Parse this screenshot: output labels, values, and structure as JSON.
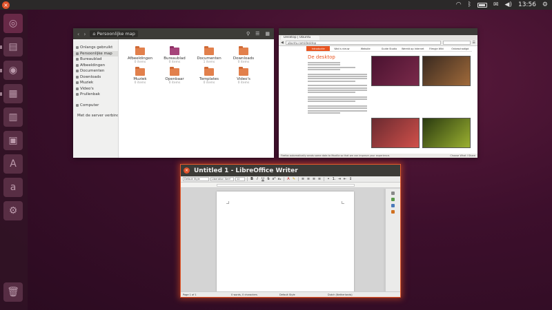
{
  "top_panel": {
    "close_glyph": "×",
    "clock": "13:56",
    "icons": [
      "wifi-icon",
      "bluetooth-icon",
      "battery-icon",
      "envelope-icon",
      "volume-icon",
      "gear-icon"
    ]
  },
  "launcher": {
    "items": [
      "dash-icon",
      "files-icon",
      "firefox-icon",
      "writer-icon",
      "calc-icon",
      "impress-icon",
      "font-icon",
      "amazon-icon",
      "settings-icon",
      "trash-icon"
    ]
  },
  "files": {
    "path": "⌂ Persoonlijke map",
    "sidebar": [
      "Onlangs gebruikt",
      "Persoonlijke map",
      "Bureaublad",
      "Afbeeldingen",
      "Documenten",
      "Downloads",
      "Muziek",
      "Video's",
      "Prullenbak",
      "Computer",
      "Met de server verbinden"
    ],
    "folders": [
      {
        "name": "Afbeeldingen",
        "count": "0 items"
      },
      {
        "name": "Bureaublad",
        "count": "0 items"
      },
      {
        "name": "Documenten",
        "count": "1 items"
      },
      {
        "name": "Downloads",
        "count": "0 items"
      },
      {
        "name": "Muziek",
        "count": "0 items"
      },
      {
        "name": "Openbaar",
        "count": "0 items"
      },
      {
        "name": "Templates",
        "count": "0 items"
      },
      {
        "name": "Video's",
        "count": "0 items"
      }
    ]
  },
  "firefox": {
    "tab_title": "Desktop | Ubuntu",
    "url": "ubuntu.com/desktop",
    "nav": [
      "Introductie",
      "Wat is nieuw",
      "Website",
      "Guide Studio",
      "Wereld op Internet",
      "Filmpje Wiki",
      "Onbeschadigd"
    ],
    "page_heading": "De desktop",
    "status": "Firefox automatically sends some data to Mozilla so that we can improve your experience.",
    "status_right": "Choose What I Share"
  },
  "writer": {
    "title": "Untitled 1 - LibreOffice Writer",
    "para_style": "Default Style",
    "font_name": "Liberation Serif",
    "font_size": "12",
    "bold": "B",
    "italic": "I",
    "underline": "U",
    "status": [
      "Page 1 of 1",
      "0 words, 0 characters",
      "Default Style",
      "Dutch (Netherlands)"
    ]
  }
}
